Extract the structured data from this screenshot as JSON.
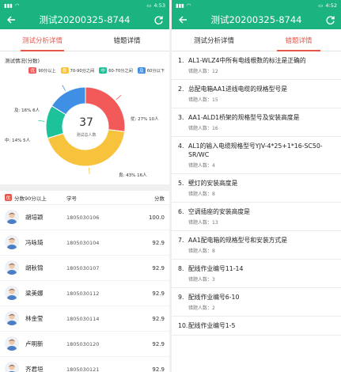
{
  "colors": {
    "brand": "#1bb380",
    "accent": "#e8584a",
    "excellent": "#f25a5a",
    "good": "#f8c33c",
    "medium": "#1ec29a",
    "pass": "#3f8fe5"
  },
  "left": {
    "status_time": "4:53",
    "title": "测试20200325-8744",
    "tabs": [
      "测试分析详情",
      "错题详情"
    ],
    "stat_title": "测试情况(分数)",
    "legend": [
      {
        "flag": "优",
        "label": "90分以上",
        "color": "#f25a5a"
      },
      {
        "flag": "良",
        "label": "70-90分之间",
        "color": "#f8c33c"
      },
      {
        "flag": "中",
        "label": "60-70分之间",
        "color": "#1ec29a"
      },
      {
        "flag": "及",
        "label": "60分以下",
        "color": "#3f8fe5"
      }
    ],
    "ring_total": "37",
    "ring_caption": "测试总人数",
    "slice_labels": {
      "excellent": "优: 27% 10人",
      "good": "良: 43% 16人",
      "medium": "中: 14% 5人",
      "pass": "及: 16% 6人"
    },
    "list_header": {
      "flag": "优",
      "group": "分数90分以上",
      "sid": "学号",
      "score": "分数"
    },
    "students": [
      {
        "name": "胡培颖",
        "sid": "1805030106",
        "score": "100.0"
      },
      {
        "name": "冯咏琦",
        "sid": "1805030104",
        "score": "92.9"
      },
      {
        "name": "胡秋锦",
        "sid": "1805030107",
        "score": "92.9"
      },
      {
        "name": "梁美娜",
        "sid": "1805030112",
        "score": "92.9"
      },
      {
        "name": "林金莹",
        "sid": "1805030114",
        "score": "92.9"
      },
      {
        "name": "卢明新",
        "sid": "1805030120",
        "score": "92.9"
      },
      {
        "name": "齐君垣",
        "sid": "1805030121",
        "score": "92.9"
      }
    ]
  },
  "chart_data": {
    "type": "pie",
    "title": "测试情况(分数)",
    "categories": [
      "优",
      "良",
      "中",
      "及"
    ],
    "values": [
      10,
      16,
      5,
      6
    ],
    "percent": [
      27,
      43,
      14,
      16
    ],
    "center_value": 37,
    "center_label": "测试总人数"
  },
  "right": {
    "status_time": "4:52",
    "title": "测试20200325-8744",
    "tabs": [
      "测试分析详情",
      "错题详情"
    ],
    "questions": [
      {
        "num": "1.",
        "text": "AL1-WLZ4中所有电线根数的标注是正确的",
        "count": "错题人数：12"
      },
      {
        "num": "2.",
        "text": "总配电箱AA1进线电缆的规格型号是",
        "count": "错题人数：15"
      },
      {
        "num": "3.",
        "text": "AA1-ALD1桥架的规格型号及安装高度是",
        "count": "错题人数：16"
      },
      {
        "num": "4.",
        "text": "AL1的输入电缆规格型号YJV-4*25+1*16-SC50-SR/WC",
        "count": "错题人数：4"
      },
      {
        "num": "5.",
        "text": "壁灯的安装高度是",
        "count": "错题人数：8"
      },
      {
        "num": "6.",
        "text": "空调插座的安装高度是",
        "count": "错题人数：13"
      },
      {
        "num": "7.",
        "text": "AA1配电箱的规格型号和安装方式是",
        "count": "错题人数：8"
      },
      {
        "num": "8.",
        "text": "配线作业编号11-14",
        "count": "错题人数：3"
      },
      {
        "num": "9.",
        "text": "配线作业编号6-10",
        "count": "错题人数：2"
      },
      {
        "num": "10.",
        "text": "配线作业编号1-5",
        "count": ""
      }
    ]
  }
}
